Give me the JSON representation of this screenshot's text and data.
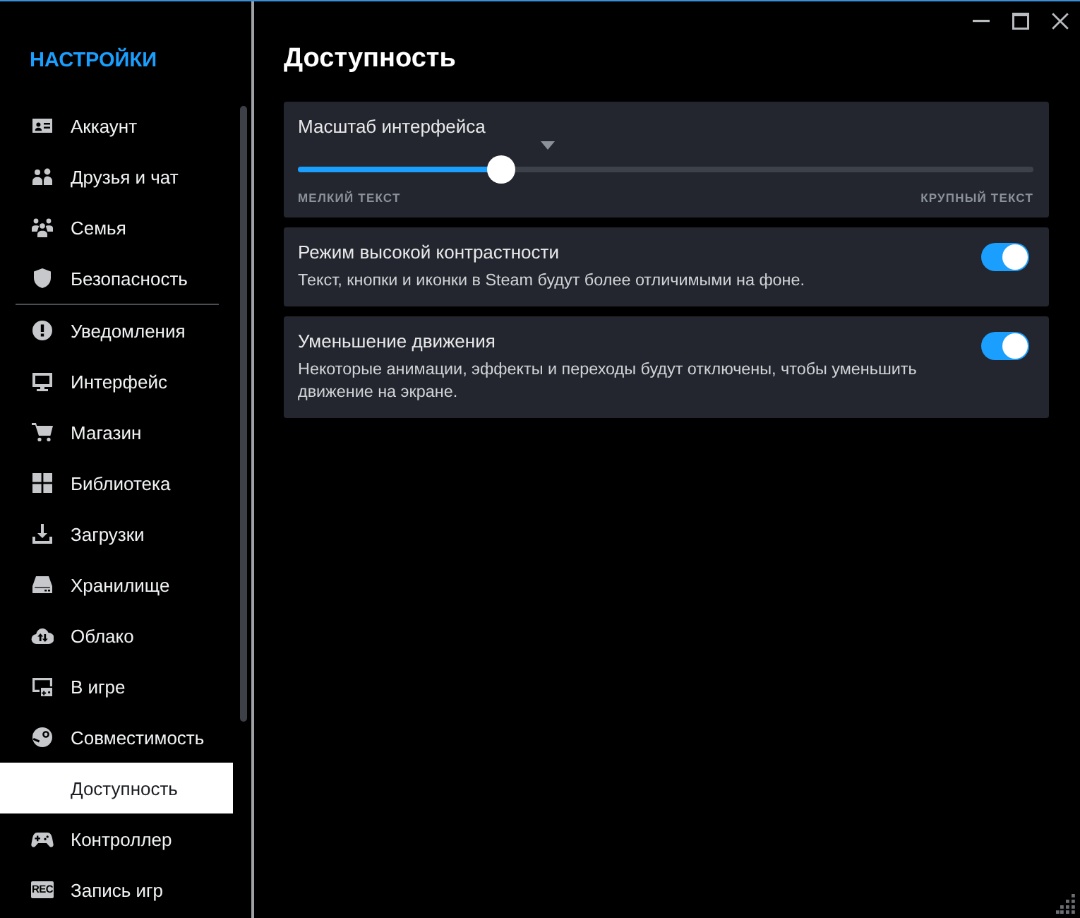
{
  "sidebar": {
    "title": "НАСТРОЙКИ",
    "sections": [
      {
        "items": [
          {
            "label": "Аккаунт",
            "selected": false
          },
          {
            "label": "Друзья и чат",
            "selected": false
          },
          {
            "label": "Семья",
            "selected": false
          },
          {
            "label": "Безопасность",
            "selected": false
          }
        ]
      },
      {
        "items": [
          {
            "label": "Уведомления",
            "selected": false
          },
          {
            "label": "Интерфейс",
            "selected": false
          },
          {
            "label": "Магазин",
            "selected": false
          },
          {
            "label": "Библиотека",
            "selected": false
          },
          {
            "label": "Загрузки",
            "selected": false
          },
          {
            "label": "Хранилище",
            "selected": false
          },
          {
            "label": "Облако",
            "selected": false
          },
          {
            "label": "В игре",
            "selected": false
          },
          {
            "label": "Совместимость",
            "selected": false
          },
          {
            "label": "Доступность",
            "selected": true
          },
          {
            "label": "Контроллер",
            "selected": false
          },
          {
            "label": "Запись игр",
            "selected": false,
            "icon_text": "REC"
          }
        ]
      }
    ]
  },
  "page": {
    "title": "Доступность"
  },
  "settings": [
    {
      "kind": "slider",
      "label": "Масштаб интерфейса",
      "level": 0.276,
      "min_label": "МЕЛКИЙ ТЕКСТ",
      "max_label": "КРУПНЫЙ ТЕКСТ"
    },
    {
      "kind": "toggle",
      "label": "Режим высокой контрастности",
      "description": "Текст, кнопки и иконки в Steam будут более отличимыми на фоне.",
      "on": true
    },
    {
      "kind": "toggle",
      "label": "Уменьшение движения",
      "description": "Некоторые анимации, эффекты и переходы будут отключены, чтобы уменьшить движение на экране.",
      "on": true
    }
  ]
}
